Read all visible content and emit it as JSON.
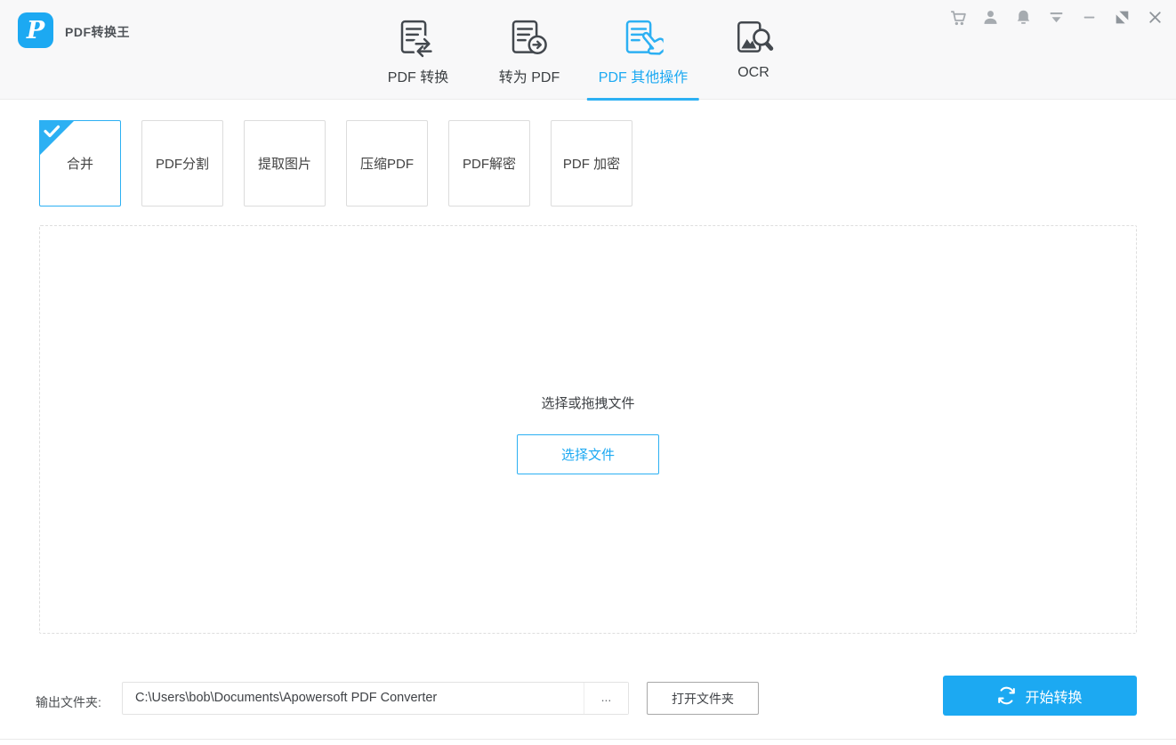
{
  "app": {
    "title": "PDF转换王",
    "logo_letter": "P",
    "accent_color": "#1ca9f2",
    "icon_gray": "#a6abb0",
    "nav_icon_color": "#43484e"
  },
  "titlebar": {
    "icons": [
      "cart-icon",
      "user-icon",
      "bell-icon",
      "menu-icon",
      "minimize-icon",
      "maximize-icon",
      "close-icon"
    ]
  },
  "nav": {
    "items": [
      {
        "label": "PDF 转换",
        "icon": "doc-swap-arrows-icon",
        "active": false
      },
      {
        "label": "转为 PDF",
        "icon": "doc-arrow-circle-icon",
        "active": false
      },
      {
        "label": "PDF 其他操作",
        "icon": "doc-hand-pointer-icon",
        "active": true
      },
      {
        "label": "OCR",
        "icon": "image-magnifier-icon",
        "active": false
      }
    ]
  },
  "tabs": {
    "items": [
      {
        "label": "合并",
        "selected": true
      },
      {
        "label": "PDF分割",
        "selected": false
      },
      {
        "label": "提取图片",
        "selected": false
      },
      {
        "label": "压缩PDF",
        "selected": false
      },
      {
        "label": "PDF解密",
        "selected": false
      },
      {
        "label": "PDF 加密",
        "selected": false
      }
    ]
  },
  "dropzone": {
    "hint": "选择或拖拽文件",
    "choose_button": "选择文件"
  },
  "footer": {
    "output_label": "输出文件夹:",
    "output_path": "C:\\Users\\bob\\Documents\\Apowersoft PDF Converter",
    "browse_label": "...",
    "open_folder_label": "打开文件夹",
    "start_label": "开始转换",
    "start_icon": "refresh-convert-icon"
  }
}
